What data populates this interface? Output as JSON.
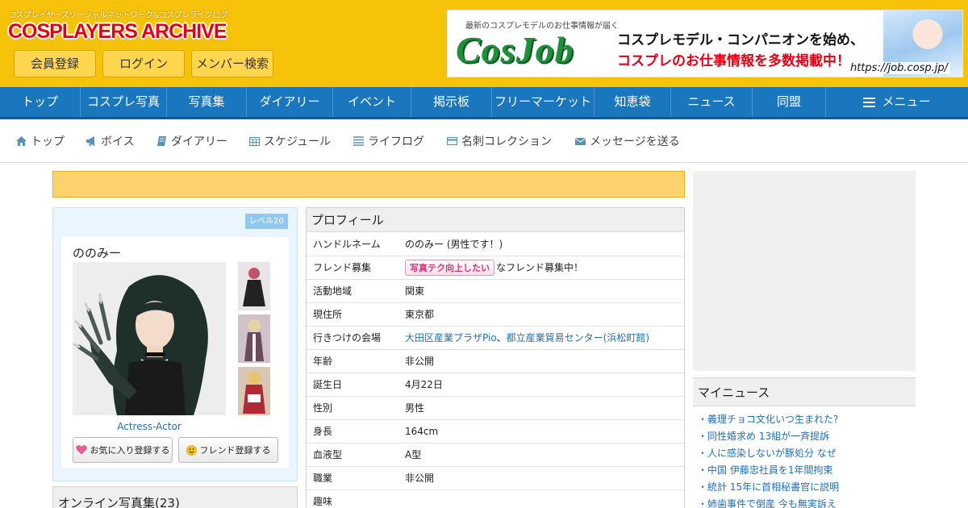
{
  "header": {
    "tagline": "コスプレイヤーズソーシャルネットワーク&コスプレライフログ",
    "logo_text": "COSPLAYERS ARCHIVE",
    "buttons": {
      "register": "会員登録",
      "login": "ログイン",
      "member_search": "メンバー検索"
    },
    "banner": {
      "small": "最新のコスプレモデルのお仕事情報が届く",
      "brand": "CosJob",
      "line1": "コスプレモデル・コンパニオンを始め、",
      "line2": "コスプレのお仕事情報を多数掲載中！",
      "url": "https://job.cosp.jp/"
    }
  },
  "main_nav": [
    "トップ",
    "コスプレ写真",
    "写真集",
    "ダイアリー",
    "イベント",
    "掲示板",
    "フリーマーケット",
    "知恵袋",
    "ニュース",
    "同盟"
  ],
  "main_nav_menu": "メニュー",
  "sub_nav": [
    {
      "label": "トップ",
      "icon": "home-icon"
    },
    {
      "label": "ボイス",
      "icon": "megaphone-icon"
    },
    {
      "label": "ダイアリー",
      "icon": "book-icon"
    },
    {
      "label": "スケジュール",
      "icon": "calendar-icon"
    },
    {
      "label": "ライフログ",
      "icon": "list-icon"
    },
    {
      "label": "名刺コレクション",
      "icon": "card-icon"
    },
    {
      "label": "メッセージを送る",
      "icon": "envelope-icon"
    }
  ],
  "user": {
    "level": "レベル20",
    "name": "ののみー",
    "role": "Actress-Actor",
    "fav_button": "お気に入り登録する",
    "friend_button": "フレンド登録する"
  },
  "online_album": "オンライン写真集(23)",
  "profile": {
    "title": "プロフィール",
    "rows": {
      "handle": {
        "k": "ハンドルネーム",
        "v": "ののみー (男性です！)"
      },
      "friend": {
        "k": "フレンド募集",
        "badge": "写真テク向上したい",
        "v": "なフレンド募集中！"
      },
      "area": {
        "k": "活動地域",
        "v": "関東"
      },
      "residence": {
        "k": "現住所",
        "v": "東京都"
      },
      "venue": {
        "k": "行きつけの会場",
        "v1": "大田区産業プラザPio",
        "sep": "、",
        "v2": "都立産業貿易センター(浜松町館)"
      },
      "age": {
        "k": "年齢",
        "v": "非公開"
      },
      "birthday": {
        "k": "誕生日",
        "v": "4月22日"
      },
      "gender": {
        "k": "性別",
        "v": "男性"
      },
      "height": {
        "k": "身長",
        "v": "164cm"
      },
      "blood": {
        "k": "血液型",
        "v": "A型"
      },
      "job": {
        "k": "職業",
        "v": "非公開"
      },
      "hobby": {
        "k": "趣味",
        "v": ""
      }
    }
  },
  "my_news": {
    "title": "マイニュース",
    "items": [
      "・義理チョコ文化いつ生まれた?",
      "・同性婚求め 13組が一斉提訴",
      "・人に感染しないが豚処分 なぜ",
      "・中国 伊藤忠社員を1年間拘束",
      "・統計 15年に首相秘書官に説明",
      "・姉歯事件で倒産 今も無実訴え"
    ]
  },
  "colors": {
    "header_bg": "#f7c20a",
    "nav_bg": "#1a76bd",
    "logo_red": "#e40012",
    "link_blue": "#1f6fb8",
    "notice_bg": "#ffd36b"
  }
}
